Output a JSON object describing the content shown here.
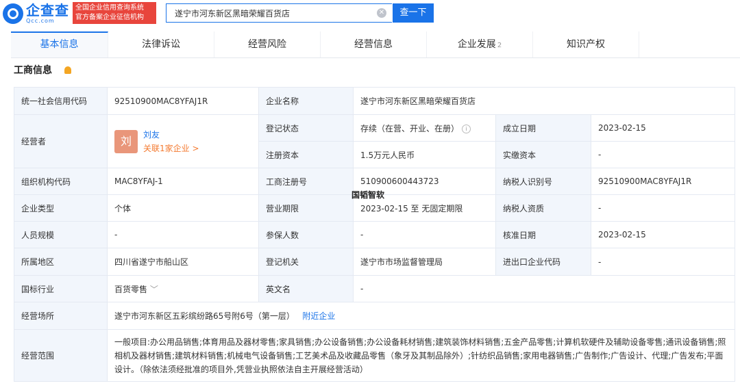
{
  "header": {
    "logo_cn": "企查查",
    "logo_en": "Qcc.com",
    "slogan_line1": "全国企业信用查询系统",
    "slogan_line2": "官方备案企业征信机构",
    "search_value": "遂宁市河东新区黑暗荣耀百货店",
    "search_button": "查一下"
  },
  "tabs": [
    {
      "label": "基本信息"
    },
    {
      "label": "法律诉讼"
    },
    {
      "label": "经营风险"
    },
    {
      "label": "经营信息"
    },
    {
      "label": "企业发展",
      "badge": "2"
    },
    {
      "label": "知识产权"
    }
  ],
  "section": {
    "title": "工商信息"
  },
  "info": {
    "credit_code_label": "统一社会信用代码",
    "credit_code": "92510900MAC8YFAJ1R",
    "company_name_label": "企业名称",
    "company_name": "遂宁市河东新区黑暗荣耀百货店",
    "operator_label": "经营者",
    "operator_avatar": "刘",
    "operator_name": "刘友",
    "operator_related": "关联1家企业 >",
    "status_label": "登记状态",
    "status": "存续（在营、开业、在册）",
    "found_date_label": "成立日期",
    "found_date": "2023-02-15",
    "reg_capital_label": "注册资本",
    "reg_capital": "1.5万元人民币",
    "paid_capital_label": "实缴资本",
    "paid_capital": "-",
    "org_code_label": "组织机构代码",
    "org_code": "MAC8YFAJ-1",
    "reg_no_label": "工商注册号",
    "reg_no": "510900600443723",
    "taxpayer_id_label": "纳税人识别号",
    "taxpayer_id": "92510900MAC8YFAJ1R",
    "type_label": "企业类型",
    "type": "个体",
    "term_label": "营业期限",
    "term": "2023-02-15 至 无固定期限",
    "taxpayer_qual_label": "纳税人资质",
    "taxpayer_qual": "-",
    "staff_label": "人员规模",
    "staff": "-",
    "insured_label": "参保人数",
    "insured": "-",
    "approve_date_label": "核准日期",
    "approve_date": "2023-02-15",
    "region_label": "所属地区",
    "region": "四川省遂宁市船山区",
    "authority_label": "登记机关",
    "authority": "遂宁市市场监督管理局",
    "import_export_label": "进出口企业代码",
    "import_export": "-",
    "industry_label": "国标行业",
    "industry": "百货零售",
    "english_name_label": "英文名",
    "english_name": "-",
    "address_label": "经营场所",
    "address": "遂宁市河东新区五彩缤纷路65号附6号（第一层）",
    "nearby_link": "附近企业",
    "scope_label": "经营范围",
    "scope": "一般项目:办公用品销售;体育用品及器材零售;家具销售;办公设备销售;办公设备耗材销售;建筑装饰材料销售;五金产品零售;计算机软硬件及辅助设备零售;通讯设备销售;照相机及器材销售;建筑材料销售;机械电气设备销售;工艺美术品及收藏品零售（象牙及其制品除外）;针纺织品销售;家用电器销售;广告制作;广告设计、代理;广告发布;平面设计。（除依法须经批准的项目外,凭营业执照依法自主开展经营活动）"
  },
  "watermark": "国韬智软"
}
